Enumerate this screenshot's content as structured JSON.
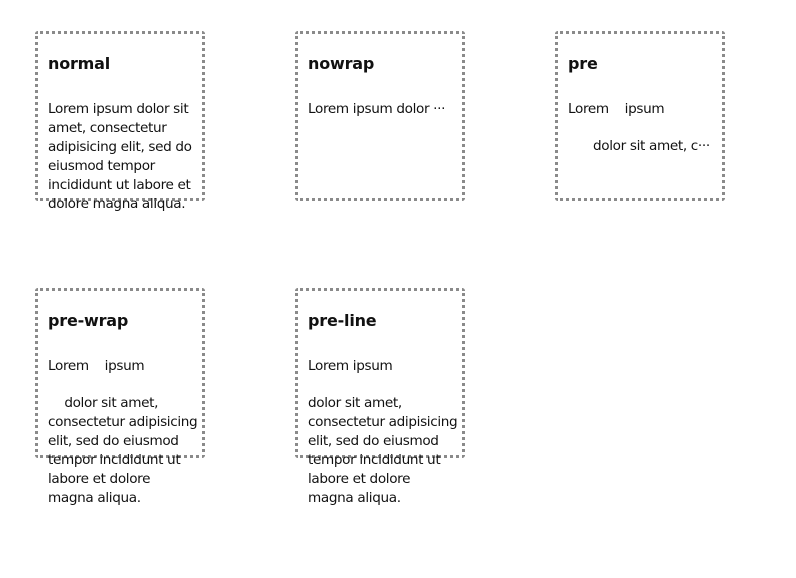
{
  "boxes": [
    {
      "title": "normal",
      "lines": [
        "Lorem ipsum dolor sit amet, consectetur adipisicing elit, sed do eiusmod tempor incididunt ut labore et dolore magna aliqua."
      ]
    },
    {
      "title": "nowrap",
      "line1": "Lorem ipsum dolor ···"
    },
    {
      "title": "pre",
      "line1": "Lorem    ipsum",
      "line2": "dolor sit amet, c···"
    },
    {
      "title": "pre-wrap",
      "line1": "Lorem    ipsum",
      "line2": "dolor sit amet, consectetur adipisicing elit, sed do eiusmod tempor incididunt ut labore et dolore magna aliqua."
    },
    {
      "title": "pre-line",
      "line1": "Lorem ipsum",
      "line2": "dolor sit amet, consectetur adipisicing elit, sed do eiusmod tempor incididunt ut labore et dolore magna aliqua."
    }
  ]
}
